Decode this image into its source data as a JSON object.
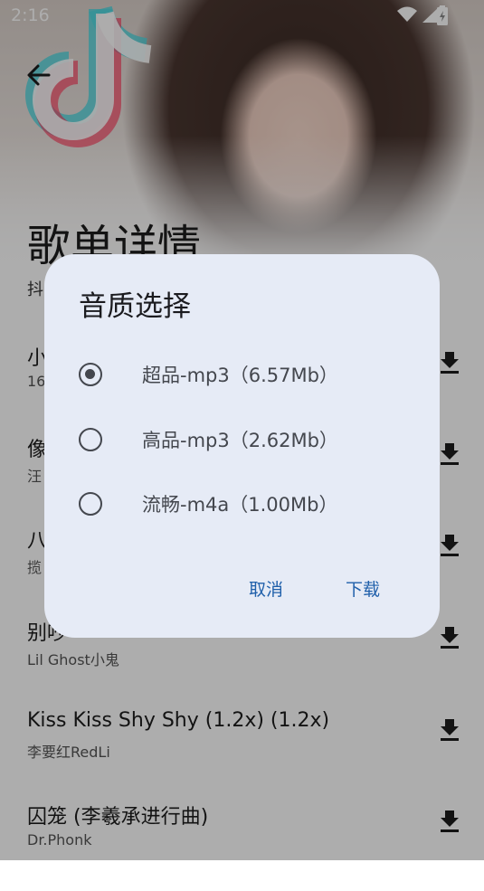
{
  "status_bar": {
    "time": "2:16"
  },
  "page": {
    "title": "歌单详情",
    "subtitle": "抖音热歌榜"
  },
  "songs": [
    {
      "title": "小城夏天",
      "artist": "16"
    },
    {
      "title": "像",
      "artist": "汪"
    },
    {
      "title": "八",
      "artist": "揽"
    },
    {
      "title": "别吵",
      "artist": "Lil Ghost小鬼"
    },
    {
      "title": "Kiss Kiss Shy Shy (1.2x) (1.2x)",
      "artist": "李要红RedLi"
    },
    {
      "title": "囚笼 (李羲承进行曲)",
      "artist": "Dr.Phonk"
    }
  ],
  "dialog": {
    "title": "音质选择",
    "options": [
      {
        "label": "超品-mp3（6.57Mb）",
        "selected": true
      },
      {
        "label": "高品-mp3（2.62Mb）",
        "selected": false
      },
      {
        "label": "流畅-m4a（1.00Mb）",
        "selected": false
      }
    ],
    "cancel_label": "取消",
    "confirm_label": "下载"
  },
  "colors": {
    "accent": "#1f5faa",
    "dialog_bg": "#e6ebf6",
    "scrim": "rgba(0,0,0,0.32)"
  },
  "icons": [
    "back-arrow-icon",
    "wifi-icon",
    "signal-icon",
    "battery-icon",
    "download-icon",
    "tiktok-logo-icon"
  ]
}
